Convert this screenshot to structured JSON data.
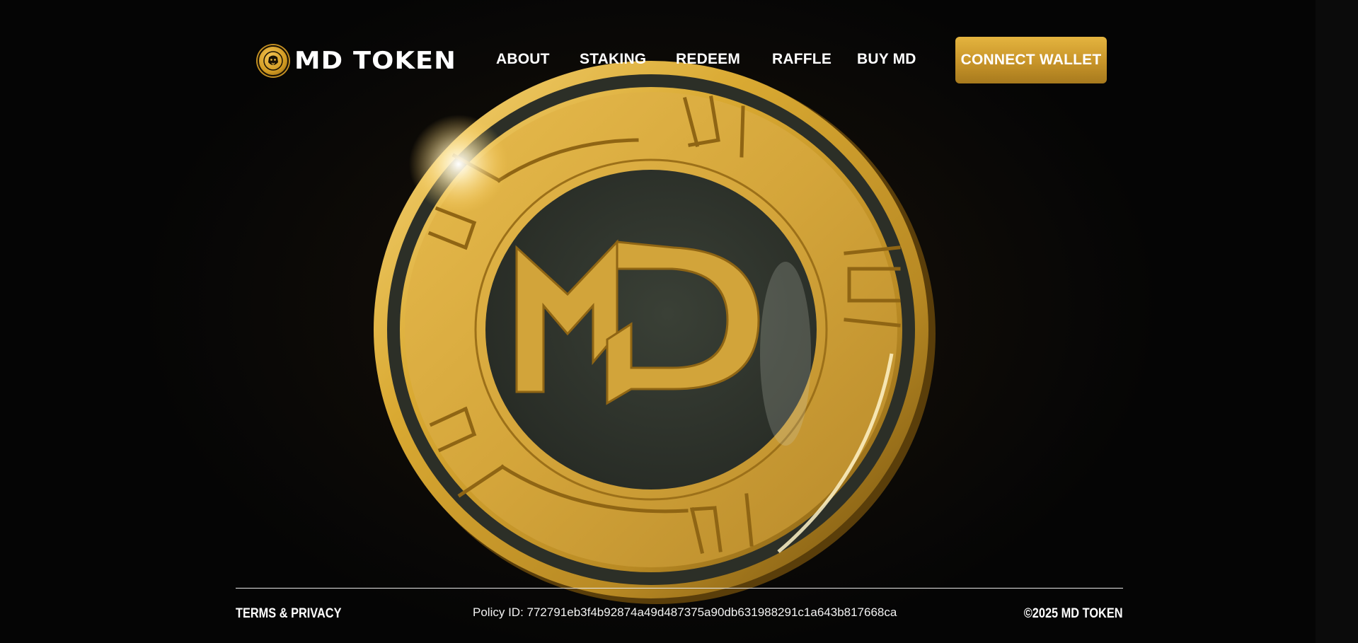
{
  "brand": {
    "name": "MD TOKEN",
    "logo_icon": "lion-coin-icon",
    "coin_monogram": "MD"
  },
  "nav": {
    "items": [
      {
        "label": "ABOUT"
      },
      {
        "label": "STAKING"
      },
      {
        "label": "REDEEM"
      },
      {
        "label": "RAFFLE"
      },
      {
        "label": "BUY MD"
      }
    ],
    "connect_label": "CONNECT WALLET"
  },
  "footer": {
    "terms_label": "TERMS & PRIVACY",
    "policy_text": "Policy ID: 772791eb3f4b92874a49d487375a90db631988291c1a643b817668ca",
    "copyright": "©2025 MD TOKEN"
  },
  "colors": {
    "background": "#050505",
    "gold": "#d9a932",
    "gold_dark": "#8a5f0d",
    "coin_center": "#2f342c",
    "text": "#ffffff"
  }
}
